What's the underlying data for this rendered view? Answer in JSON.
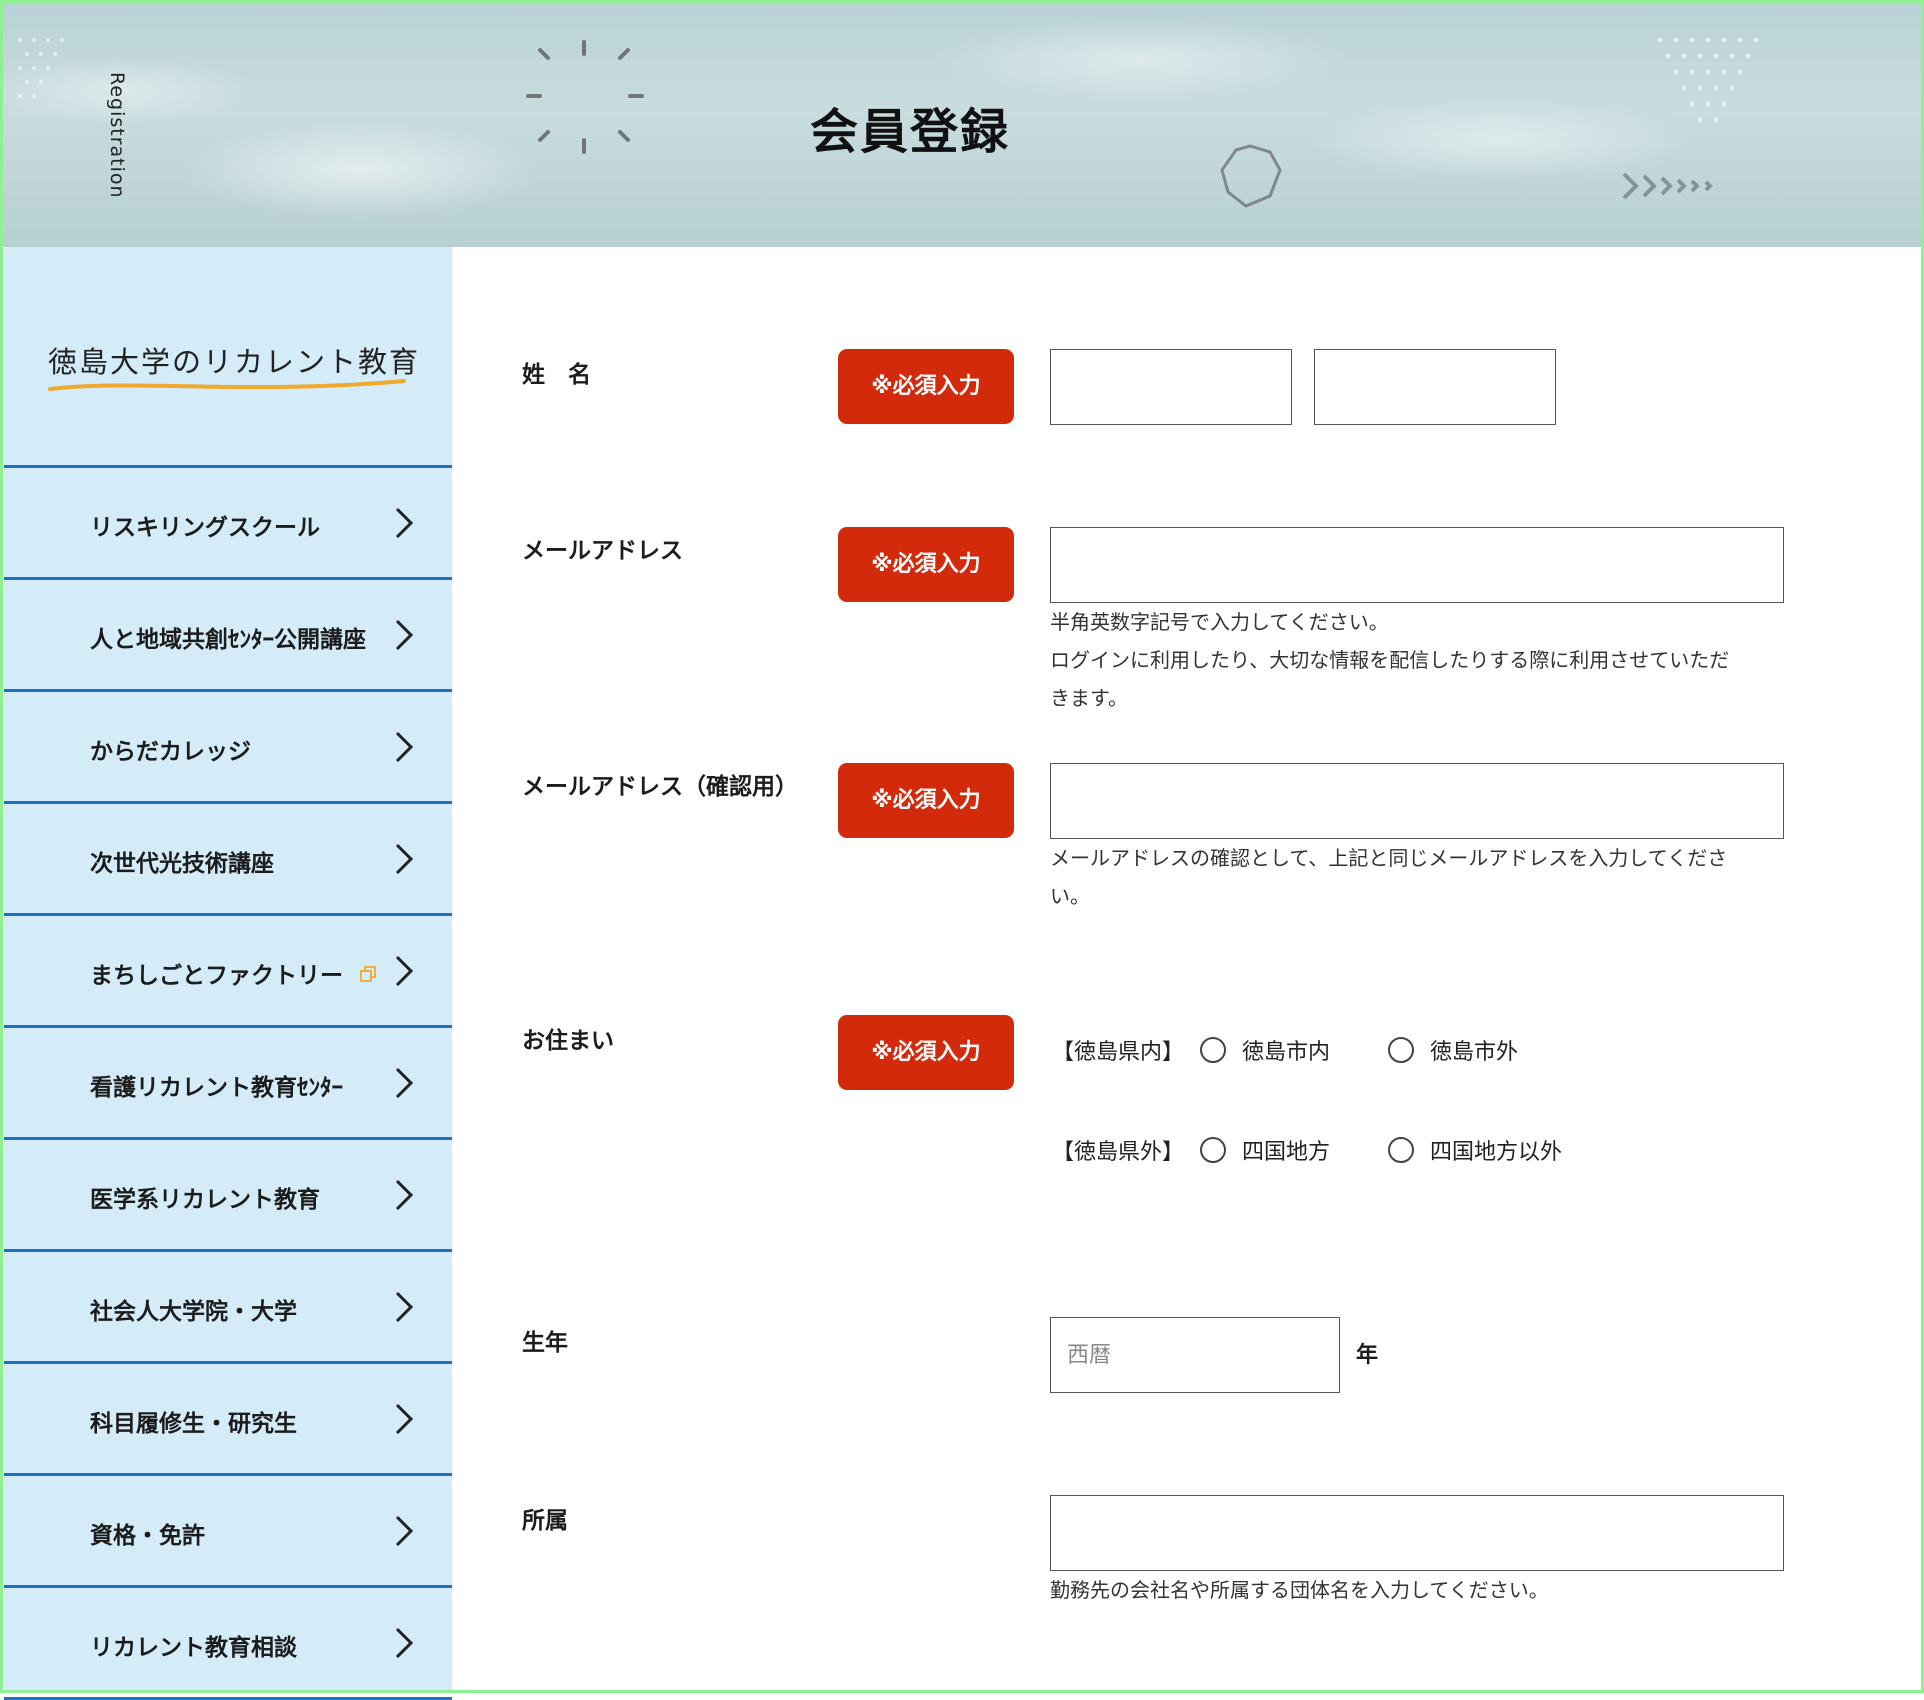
{
  "banner": {
    "side_label": "Registration",
    "title": "会員登録"
  },
  "sidebar": {
    "logo_text": "徳島大学のリカレント教育",
    "items": [
      {
        "label": "リスキリングスクール"
      },
      {
        "label": "人と地域共創ｾﾝﾀｰ公開講座"
      },
      {
        "label": "からだカレッジ"
      },
      {
        "label": "次世代光技術講座"
      },
      {
        "label": "まちしごとファクトリー",
        "external": true
      },
      {
        "label": "看護リカレント教育ｾﾝﾀｰ"
      },
      {
        "label": "医学系リカレント教育"
      },
      {
        "label": "社会人大学院・大学"
      },
      {
        "label": "科目履修生・研究生"
      },
      {
        "label": "資格・免許"
      },
      {
        "label": "リカレント教育相談"
      }
    ]
  },
  "form": {
    "required_badge": "※必須入力",
    "name": {
      "label": "姓　名",
      "last_value": "",
      "first_value": ""
    },
    "email": {
      "label": "メールアドレス",
      "value": "",
      "help_line1": "半角英数字記号で入力してください。",
      "help_line2": "ログインに利用したり、大切な情報を配信したりする際に利用させていただ",
      "help_line3": "きます。"
    },
    "email_confirm": {
      "label": "メールアドレス（確認用）",
      "value": "",
      "help_line1": "メールアドレスの確認として、上記と同じメールアドレスを入力してくださ",
      "help_line2": "い。"
    },
    "residence": {
      "label": "お住まい",
      "inside_group": "【徳島県内】",
      "inside_options": [
        "徳島市内",
        "徳島市外"
      ],
      "outside_group": "【徳島県外】",
      "outside_options": [
        "四国地方",
        "四国地方以外"
      ]
    },
    "birth_year": {
      "label": "生年",
      "placeholder": "西暦",
      "unit": "年"
    },
    "affiliation": {
      "label": "所属",
      "value": "",
      "help": "勤務先の会社名や所属する団体名を入力してください。"
    }
  },
  "colors": {
    "required_badge": "#d42a0c",
    "sidebar_bg": "#d4ebf8",
    "nav_divider": "#1f6fc2",
    "logo_underline": "#f0a92a"
  },
  "icons": {
    "nav_arrow": "chevron-right-icon",
    "external": "external-link-icon"
  }
}
